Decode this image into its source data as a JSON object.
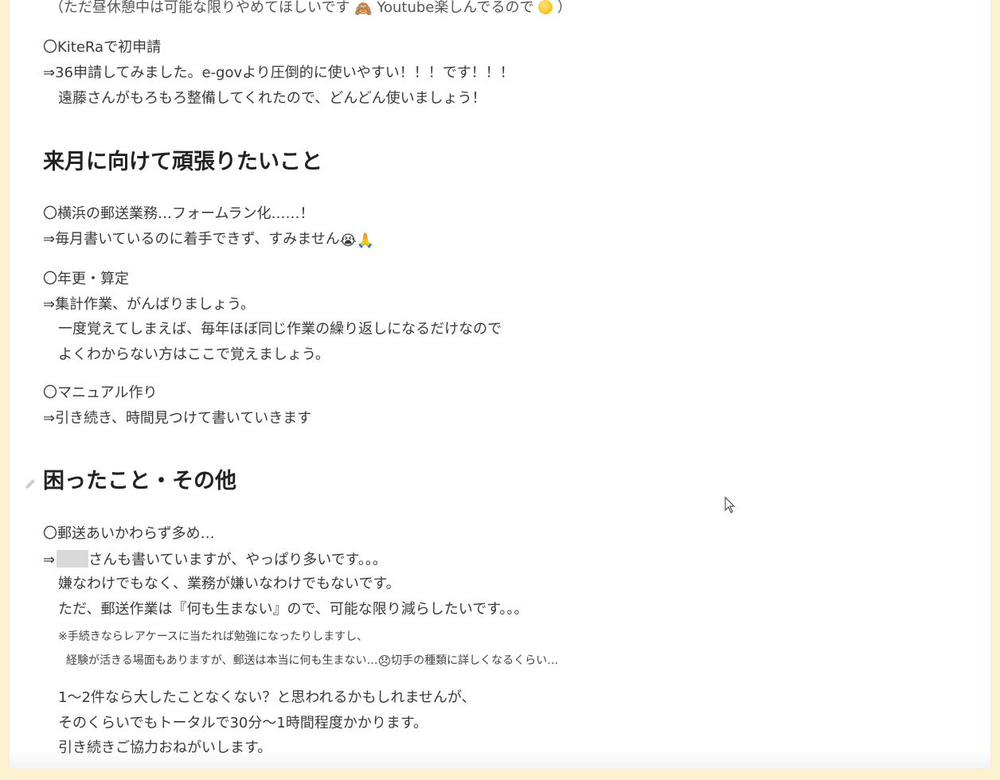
{
  "lines": {
    "top_partial": "（ただ昼休憩中は可能な限りやめてほしいです",
    "top_partial_youtube": "Youtube楽しんでるので",
    "top_partial_end": "）",
    "kitera_head": "〇KiteRaで初申請",
    "kitera_1": "⇒36申請してみました。e-govより圧倒的に使いやすい！！！です！！！",
    "kitera_2": "遠藤さんがもろもろ整備してくれたので、どんどん使いましょう！"
  },
  "section_next": {
    "title": "来月に向けて頑張りたいこと",
    "item1_head": "〇横浜の郵送業務…フォームラン化……！",
    "item1_body": "⇒毎月書いているのに着手できず、すみません",
    "item2_head": "〇年更・算定",
    "item2_body1": "⇒集計作業、がんばりましょう。",
    "item2_body2": "一度覚えてしまえば、毎年ほぼ同じ作業の繰り返しになるだけなので",
    "item2_body3": "よくわからない方はここで覚えましょう。",
    "item3_head": "〇マニュアル作り",
    "item3_body": "⇒引き続き、時間見つけて書いていきます"
  },
  "section_trouble": {
    "title": "困ったこと・その他",
    "item1_head": "〇郵送あいかわらず多め…",
    "item1_arrow": "⇒",
    "item1_body1": "さんも書いていますが、やっぱり多いです。。。",
    "item1_body2": "嫌なわけでもなく、業務が嫌いなわけでもないです。",
    "item1_body3": "ただ、郵送作業は『何も生まない』ので、可能な限り減らしたいです。。。",
    "note1": "※手続きならレアケースに当たれば勉強になったりしますし、",
    "note2": "経験が活きる場面もありますが、郵送は本当に何も生まない…",
    "note2_end": "切手の種類に詳しくなるくらい…",
    "para1": "1〜2件なら大したことなくない？と思われるかもしれませんが、",
    "para2": "そのくらいでもトータルで30分〜1時間程度かかります。",
    "para3": "引き続きご協力おねがいします。"
  }
}
